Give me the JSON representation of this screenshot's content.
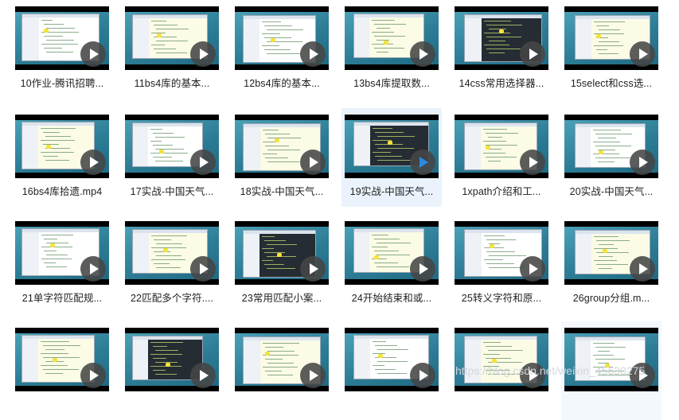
{
  "videos": [
    {
      "title": "10作业-腾讯招聘..."
    },
    {
      "title": "11bs4库的基本..."
    },
    {
      "title": "12bs4库的基本..."
    },
    {
      "title": "13bs4库提取数..."
    },
    {
      "title": "14css常用选择器..."
    },
    {
      "title": "15select和css选..."
    },
    {
      "title": "16bs4库拾遗.mp4"
    },
    {
      "title": "17实战-中国天气..."
    },
    {
      "title": "18实战-中国天气..."
    },
    {
      "title": "19实战-中国天气..."
    },
    {
      "title": "1xpath介绍和工..."
    },
    {
      "title": "20实战-中国天气..."
    },
    {
      "title": "21单字符匹配规..."
    },
    {
      "title": "22匹配多个字符...."
    },
    {
      "title": "23常用匹配小案..."
    },
    {
      "title": "24开始结束和或..."
    },
    {
      "title": "25转义字符和原..."
    },
    {
      "title": "26group分组.m..."
    },
    {
      "title": ""
    },
    {
      "title": ""
    },
    {
      "title": ""
    },
    {
      "title": ""
    },
    {
      "title": ""
    },
    {
      "title": ""
    }
  ],
  "selected_index": 9,
  "hover_index": 23,
  "play_icon": "play-icon",
  "accent_color": "#2a8ae2",
  "watermark": "https://blog.csdn.net/weixin_45630275"
}
